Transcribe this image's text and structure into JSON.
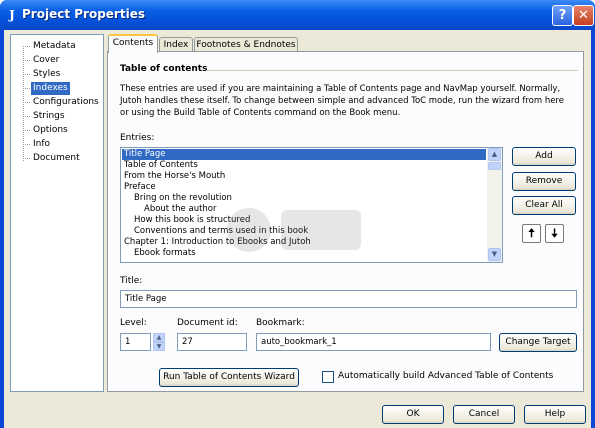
{
  "window": {
    "title": "Project Properties",
    "app_icon_glyph": "J",
    "help_glyph": "?",
    "close_glyph": "✕"
  },
  "sidebar": {
    "items": [
      {
        "label": "Metadata",
        "selected": false
      },
      {
        "label": "Cover",
        "selected": false
      },
      {
        "label": "Styles",
        "selected": false
      },
      {
        "label": "Indexes",
        "selected": true
      },
      {
        "label": "Configurations",
        "selected": false
      },
      {
        "label": "Strings",
        "selected": false
      },
      {
        "label": "Options",
        "selected": false
      },
      {
        "label": "Info",
        "selected": false
      },
      {
        "label": "Document",
        "selected": false
      }
    ]
  },
  "tabs": [
    {
      "label": "Contents",
      "active": true
    },
    {
      "label": "Index",
      "active": false
    },
    {
      "label": "Footnotes & Endnotes",
      "active": false
    }
  ],
  "toc": {
    "section_title": "Table of contents",
    "description": "These entries are used if you are maintaining a Table of Contents page and NavMap yourself. Normally, Jutoh handles these itself. To change between simple and advanced ToC mode, run the wizard from here or using the Build Table of Contents command on the Book menu.",
    "entries_label": "Entries:",
    "entries": [
      {
        "text": "Title Page",
        "level": 0,
        "selected": true
      },
      {
        "text": "Table of Contents",
        "level": 0,
        "selected": false
      },
      {
        "text": "From the Horse's Mouth",
        "level": 0,
        "selected": false
      },
      {
        "text": "Preface",
        "level": 0,
        "selected": false
      },
      {
        "text": "Bring on the revolution",
        "level": 1,
        "selected": false
      },
      {
        "text": "About the author",
        "level": 2,
        "selected": false
      },
      {
        "text": "How this book is structured",
        "level": 1,
        "selected": false
      },
      {
        "text": "Conventions and terms used in this book",
        "level": 1,
        "selected": false
      },
      {
        "text": "Chapter 1: Introduction to Ebooks and Jutoh",
        "level": 0,
        "selected": false
      },
      {
        "text": "Ebook formats",
        "level": 1,
        "selected": false
      }
    ],
    "add_label": "Add",
    "remove_label": "Remove",
    "clear_all_label": "Clear All",
    "move_up_glyph": "🠅",
    "move_down_glyph": "🠇",
    "title_label": "Title:",
    "title_value": "Title Page",
    "level_label": "Level:",
    "level_value": "1",
    "document_id_label": "Document id:",
    "document_id_value": "27",
    "bookmark_label": "Bookmark:",
    "bookmark_value": "auto_bookmark_1",
    "change_target_label": "Change Target",
    "wizard_label": "Run Table of Contents Wizard",
    "auto_build_label": "Automatically build Advanced Table of Contents",
    "auto_build_checked": false
  },
  "footer": {
    "ok_label": "OK",
    "cancel_label": "Cancel",
    "help_label": "Help"
  },
  "colors": {
    "titlebar": "#0a5fe6",
    "selection": "#316ac5",
    "dialog_bg": "#ece9d8",
    "tab_highlight": "#ffc83c"
  }
}
